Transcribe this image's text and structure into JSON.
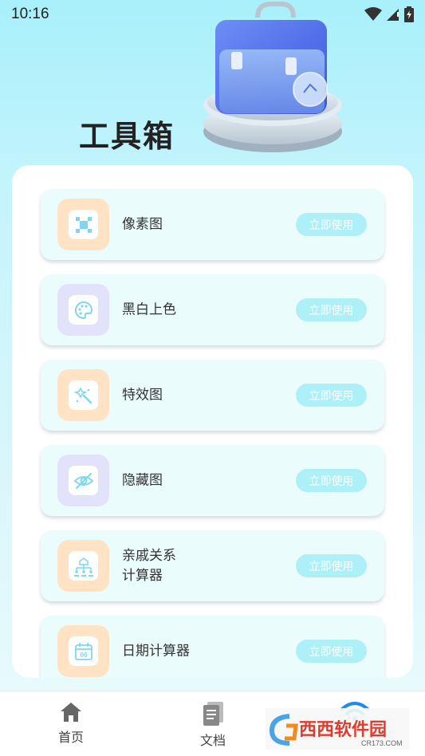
{
  "status_bar": {
    "time": "10:16"
  },
  "header": {
    "title": "工具箱"
  },
  "tools": [
    {
      "label": "像素图",
      "button": "立即使用",
      "icon": "pixel-icon",
      "tone": "orange"
    },
    {
      "label": "黑白上色",
      "button": "立即使用",
      "icon": "palette-icon",
      "tone": "purple"
    },
    {
      "label": "特效图",
      "button": "立即使用",
      "icon": "magic-wand-icon",
      "tone": "orange"
    },
    {
      "label": "隐藏图",
      "button": "立即使用",
      "icon": "eye-hidden-icon",
      "tone": "purple"
    },
    {
      "label": "亲戚关系\n计算器",
      "button": "立即使用",
      "icon": "family-tree-icon",
      "tone": "orange"
    },
    {
      "label": "日期计算器",
      "button": "立即使用",
      "icon": "calendar-icon",
      "tone": "orange",
      "calendar_day": "06"
    }
  ],
  "bottom_nav": [
    {
      "label": "首页",
      "icon": "home-icon"
    },
    {
      "label": "文档",
      "icon": "document-icon"
    },
    {
      "label": "",
      "icon": "wifi-icon"
    }
  ],
  "watermark": {
    "text": "西西软件园",
    "sub": "CR173.COM"
  },
  "colors": {
    "accent": "#7fd7ee",
    "button_bg": "#aef0f8",
    "card_item_bg": "#ebfcfd",
    "icon_orange": "#ffe3c4",
    "icon_purple": "#e2e3fb",
    "wifi_active": "#1f8de8"
  }
}
